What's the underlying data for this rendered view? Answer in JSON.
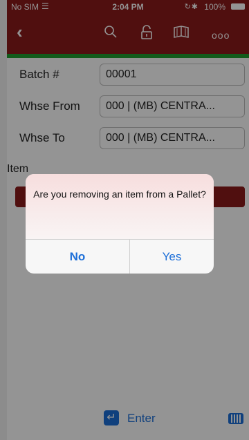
{
  "status_bar": {
    "carrier": "No SIM",
    "time": "2:04 PM",
    "battery": "100%"
  },
  "nav": {
    "icons": [
      "back-icon",
      "search-icon",
      "unlock-icon",
      "book-icon",
      "more-icon"
    ],
    "more_glyph": "ooo"
  },
  "form": {
    "batch_label": "Batch #",
    "batch_value": "00001",
    "whse_from_label": "Whse From",
    "whse_from_value": "000 | (MB) CENTRA...",
    "whse_to_label": "Whse To",
    "whse_to_value": "000 | (MB) CENTRA...",
    "item_label": "Item"
  },
  "bottom_bar": {
    "enter_label": "Enter"
  },
  "alert": {
    "message": "Are you removing an item from a Pallet?",
    "no_label": "No",
    "yes_label": "Yes"
  },
  "colors": {
    "brand": "#8b1a1a",
    "accent": "#1d6fd8",
    "success_strip": "#1f9d2f"
  }
}
